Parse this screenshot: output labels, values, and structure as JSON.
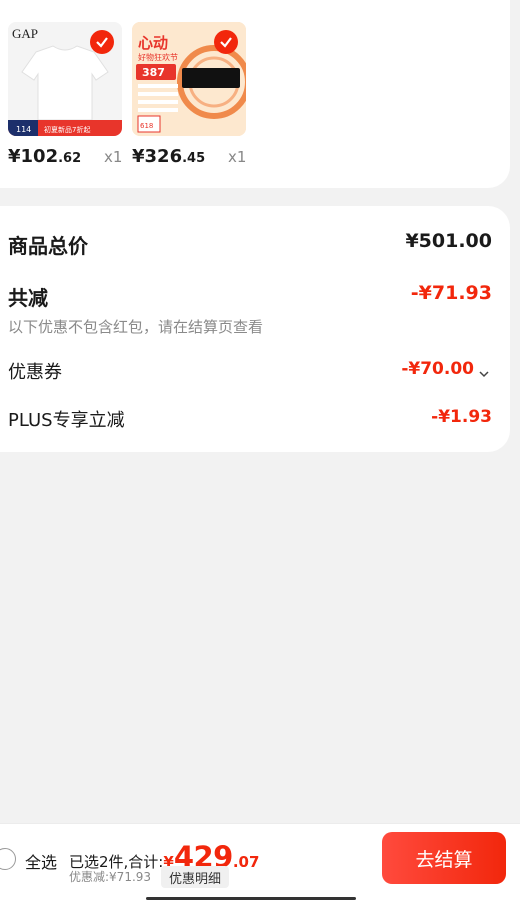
{
  "items": [
    {
      "name": "gap-tshirt",
      "brand_text": "GAP",
      "price_tag": "114",
      "promo_text": "初夏新品7折起",
      "price_int": "¥102",
      "price_dec": ".62",
      "qty": "x1"
    },
    {
      "name": "seagate-ssd",
      "promo_title": "心动",
      "promo_sub": "好物狂欢节",
      "promo_price": "387",
      "promo_bottom": "618",
      "price_int": "¥326",
      "price_dec": ".45",
      "qty": "x1"
    }
  ],
  "summary": {
    "total_label": "商品总价",
    "total_value": "¥501.00",
    "reduce_label": "共减",
    "reduce_value": "-¥71.93",
    "note": "以下优惠不包含红包，请在结算页查看",
    "coupon_label": "优惠券",
    "coupon_value": "-¥70.00",
    "plus_label": "PLUS专享立减",
    "plus_value": "-¥1.93"
  },
  "bottom": {
    "select_all": "全选",
    "selected_text": "已选2件,合计:",
    "currency": "¥",
    "amount_int": "429",
    "amount_dec": ".07",
    "discount_text": "优惠减:¥71.93",
    "detail_btn": "优惠明细",
    "checkout": "去结算"
  },
  "colors": {
    "accent": "#f2270c",
    "bg": "#f2f2f2"
  },
  "icons": [
    "check-icon",
    "chevron-down-icon",
    "radio-icon"
  ]
}
